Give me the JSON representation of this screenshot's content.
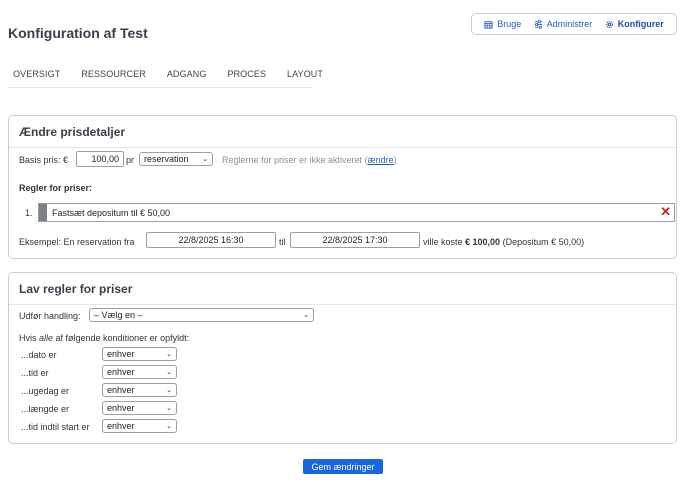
{
  "page_title": "Konfiguration af Test",
  "topnav": {
    "items": [
      {
        "label": "Bruge",
        "icon": "calendar-icon"
      },
      {
        "label": "Administrer",
        "icon": "sliders-icon"
      },
      {
        "label": "Konfigurer",
        "icon": "gear-icon",
        "active": true
      }
    ]
  },
  "tabs": [
    "OVERSIGT",
    "RESSOURCER",
    "ADGANG",
    "PROCES",
    "LAYOUT"
  ],
  "price_details": {
    "title": "Ændre prisdetaljer",
    "base_price_label": "Basis pris: €",
    "base_price_value": "100,00",
    "per_label": "pr",
    "per_unit": "reservation",
    "rules_note_prefix": "Reglerne for priser er ikke aktiveret (",
    "rules_note_link": "ændre",
    "rules_note_suffix": ")",
    "rules_heading": "Regler for priser:",
    "rules": [
      {
        "number": "1.",
        "text": "Fastsæt depositum til € 50,00"
      }
    ],
    "example_prefix": "Eksempel: En reservation fra",
    "example_from": "22/8/2025 16:30",
    "example_to_label": "til",
    "example_to": "22/8/2025 17:30",
    "example_cost_label": "ville koste",
    "example_cost": "€ 100,00",
    "example_deposit": "(Depositum € 50,00)"
  },
  "make_rules": {
    "title": "Lav regler for priser",
    "action_label": "Udfør handling:",
    "action_value": "– Vælg en –",
    "conditions_prefix": "Hvis ",
    "conditions_em": "alle",
    "conditions_suffix": " af følgende konditioner er opfyldt:",
    "conditions": [
      {
        "label": "...dato er",
        "value": "enhver"
      },
      {
        "label": "...tid er",
        "value": "enhver"
      },
      {
        "label": "...ugedag er",
        "value": "enhver"
      },
      {
        "label": "...længde er",
        "value": "enhver"
      },
      {
        "label": "...tid indtil start er",
        "value": "enhver"
      }
    ]
  },
  "save_button": "Gem ændringer",
  "colors": {
    "accent": "#1a66e0",
    "link": "#1f5fbf",
    "danger": "#d21f1f"
  }
}
